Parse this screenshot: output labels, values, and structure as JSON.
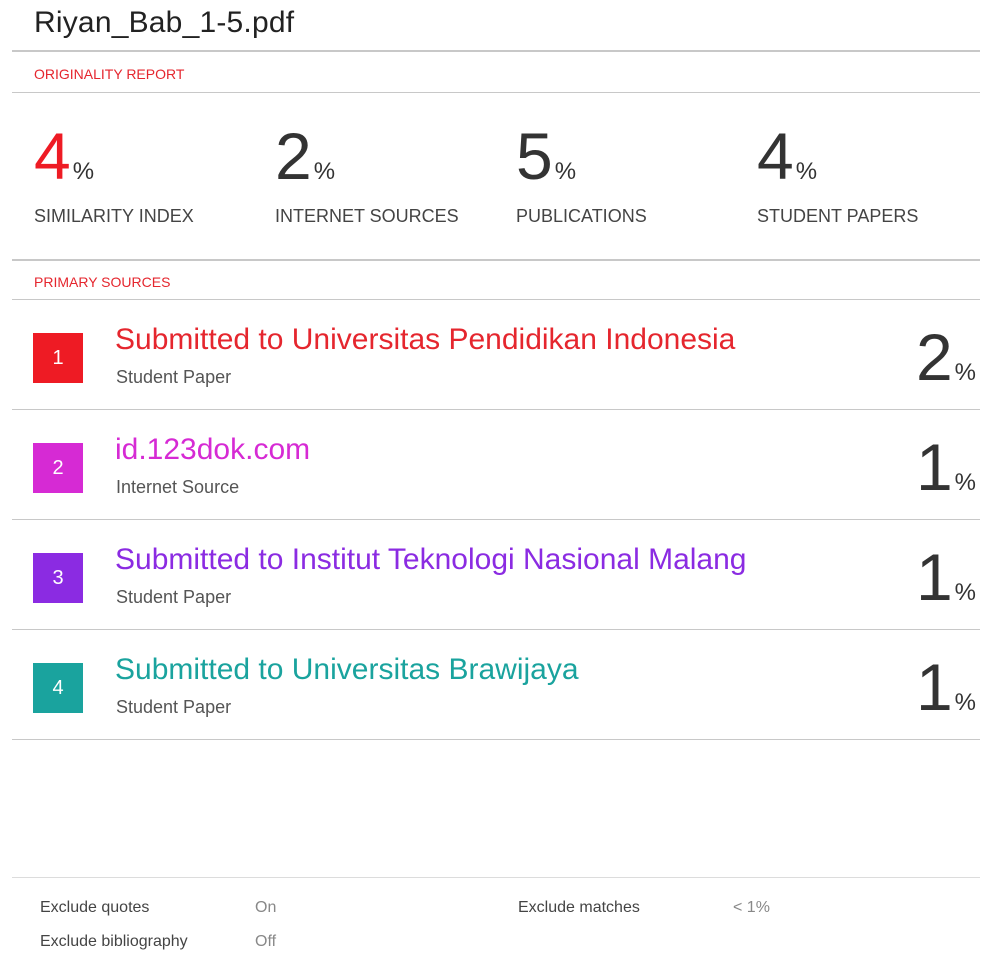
{
  "document": {
    "title": "Riyan_Bab_1-5.pdf"
  },
  "originality_report": {
    "label": "ORIGINALITY REPORT",
    "stats": [
      {
        "value": "4",
        "unit": "%",
        "caption": "SIMILARITY INDEX",
        "color": "#ee1b24"
      },
      {
        "value": "2",
        "unit": "%",
        "caption": "INTERNET SOURCES"
      },
      {
        "value": "5",
        "unit": "%",
        "caption": "PUBLICATIONS"
      },
      {
        "value": "4",
        "unit": "%",
        "caption": "STUDENT PAPERS"
      }
    ]
  },
  "primary_sources": {
    "label": "PRIMARY SOURCES",
    "items": [
      {
        "rank": "1",
        "title": "Submitted to Universitas Pendidikan Indonesia",
        "type": "Student Paper",
        "percent": "2",
        "unit": "%",
        "color": "#ee1b24"
      },
      {
        "rank": "2",
        "title": "id.123dok.com",
        "type": "Internet Source",
        "percent": "1",
        "unit": "%",
        "color": "#d62ad4"
      },
      {
        "rank": "3",
        "title": "Submitted to Institut Teknologi Nasional Malang",
        "type": "Student Paper",
        "percent": "1",
        "unit": "%",
        "color": "#8b2be2"
      },
      {
        "rank": "4",
        "title": "Submitted to Universitas Brawijaya",
        "type": "Student Paper",
        "percent": "1",
        "unit": "%",
        "color": "#1aa39e"
      }
    ]
  },
  "footer": {
    "exclude_quotes_label": "Exclude quotes",
    "exclude_quotes_value": "On",
    "exclude_bibliography_label": "Exclude bibliography",
    "exclude_bibliography_value": "Off",
    "exclude_matches_label": "Exclude matches",
    "exclude_matches_value": "< 1%"
  }
}
